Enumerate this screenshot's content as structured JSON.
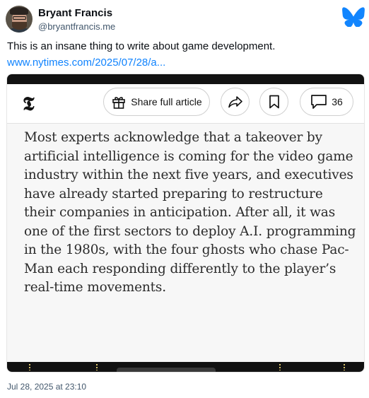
{
  "author": {
    "name": "Bryant Francis",
    "handle": "@bryantfrancis.me"
  },
  "post": {
    "text": "This is an insane thing to write about game development.",
    "link": "www.nytimes.com/2025/07/28/a..."
  },
  "embed": {
    "toolbar": {
      "logo_glyph": "𝕿",
      "share_label": "Share full article",
      "comment_count": "36"
    },
    "article_text": "Most experts acknowledge that a takeover by artificial intelligence is coming for the video game industry within the next five years, and executives have already started preparing to restructure their companies in anticipation. After all, it was one of the first sectors to deploy A.I. programming in the 1980s, with the four ghosts who chase Pac-Man each responding differently to the player’s real-time movements."
  },
  "timestamp": "Jul 28, 2025 at 23:10",
  "colors": {
    "link": "#1083fe",
    "bluesky": "#1185fe",
    "muted": "#42576c"
  },
  "icons": {
    "platform": "bluesky-butterfly-icon",
    "share": "gift-icon",
    "forward": "share-arrow-icon",
    "bookmark": "bookmark-icon",
    "comments": "comment-bubble-icon"
  }
}
